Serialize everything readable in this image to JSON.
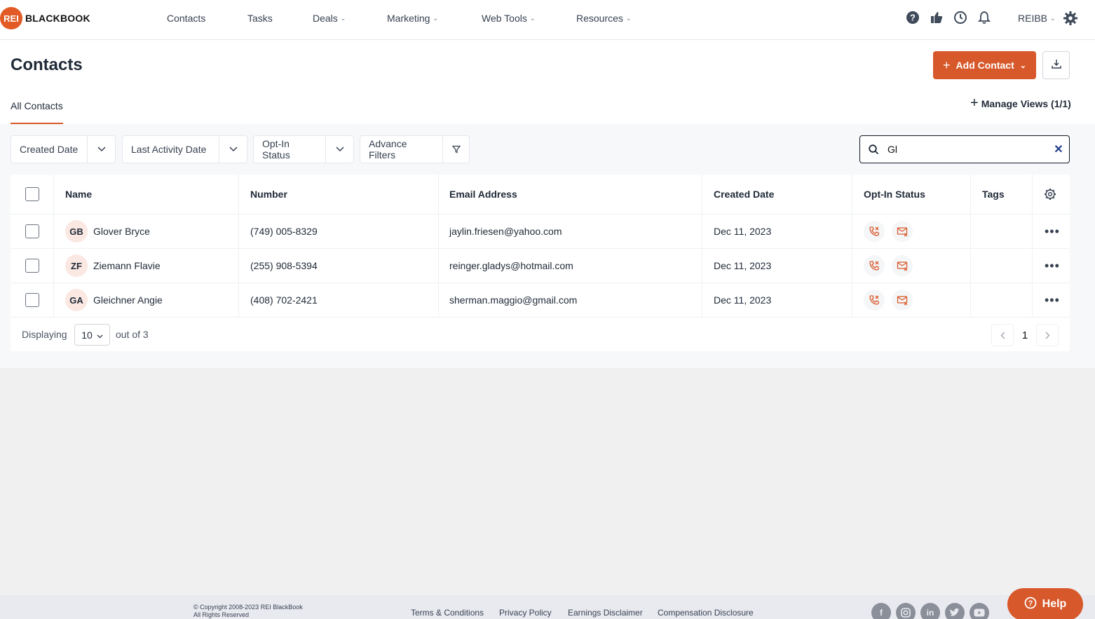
{
  "brand": {
    "badge": "REI",
    "name": "BLACKBOOK"
  },
  "nav": [
    {
      "label": "Contacts",
      "caret": false
    },
    {
      "label": "Tasks",
      "caret": false
    },
    {
      "label": "Deals",
      "caret": true
    },
    {
      "label": "Marketing",
      "caret": true
    },
    {
      "label": "Web Tools",
      "caret": true
    },
    {
      "label": "Resources",
      "caret": true
    }
  ],
  "account": "REIBB",
  "page": {
    "title": "Contacts",
    "add_contact": "Add Contact",
    "tab_all": "All Contacts",
    "manage_views": "Manage Views (1/1)"
  },
  "filters": {
    "created_date": "Created Date",
    "last_activity": "Last Activity Date",
    "optin": "Opt-In Status",
    "advance": "Advance Filters"
  },
  "search": {
    "value": "Gl"
  },
  "table": {
    "headers": {
      "name": "Name",
      "number": "Number",
      "email": "Email Address",
      "created": "Created Date",
      "optin": "Opt-In Status",
      "tags": "Tags"
    },
    "rows": [
      {
        "initials": "GB",
        "name": "Glover Bryce",
        "number": "(749) 005-8329",
        "email": "jaylin.friesen@yahoo.com",
        "created": "Dec 11, 2023"
      },
      {
        "initials": "ZF",
        "name": "Ziemann Flavie",
        "number": "(255) 908-5394",
        "email": "reinger.gladys@hotmail.com",
        "created": "Dec 11, 2023"
      },
      {
        "initials": "GA",
        "name": "Gleichner Angie",
        "number": "(408) 702-2421",
        "email": "sherman.maggio@gmail.com",
        "created": "Dec 11, 2023"
      }
    ]
  },
  "pagination": {
    "displaying": "Displaying",
    "per_page": "10",
    "out_of": "out of 3",
    "current_page": "1"
  },
  "footer": {
    "copyright_line1": "© Copyright 2008-2023 REI BlackBook",
    "copyright_line2": "All Rights Reserved",
    "links": [
      "Terms & Conditions",
      "Privacy Policy",
      "Earnings Disclaimer",
      "Compensation Disclosure"
    ],
    "social": [
      "facebook-icon",
      "instagram-icon",
      "linkedin-icon",
      "twitter-icon",
      "youtube-icon"
    ]
  },
  "help": "Help",
  "colors": {
    "accent": "#d7582a",
    "icon_dark": "#3f4a5a"
  }
}
